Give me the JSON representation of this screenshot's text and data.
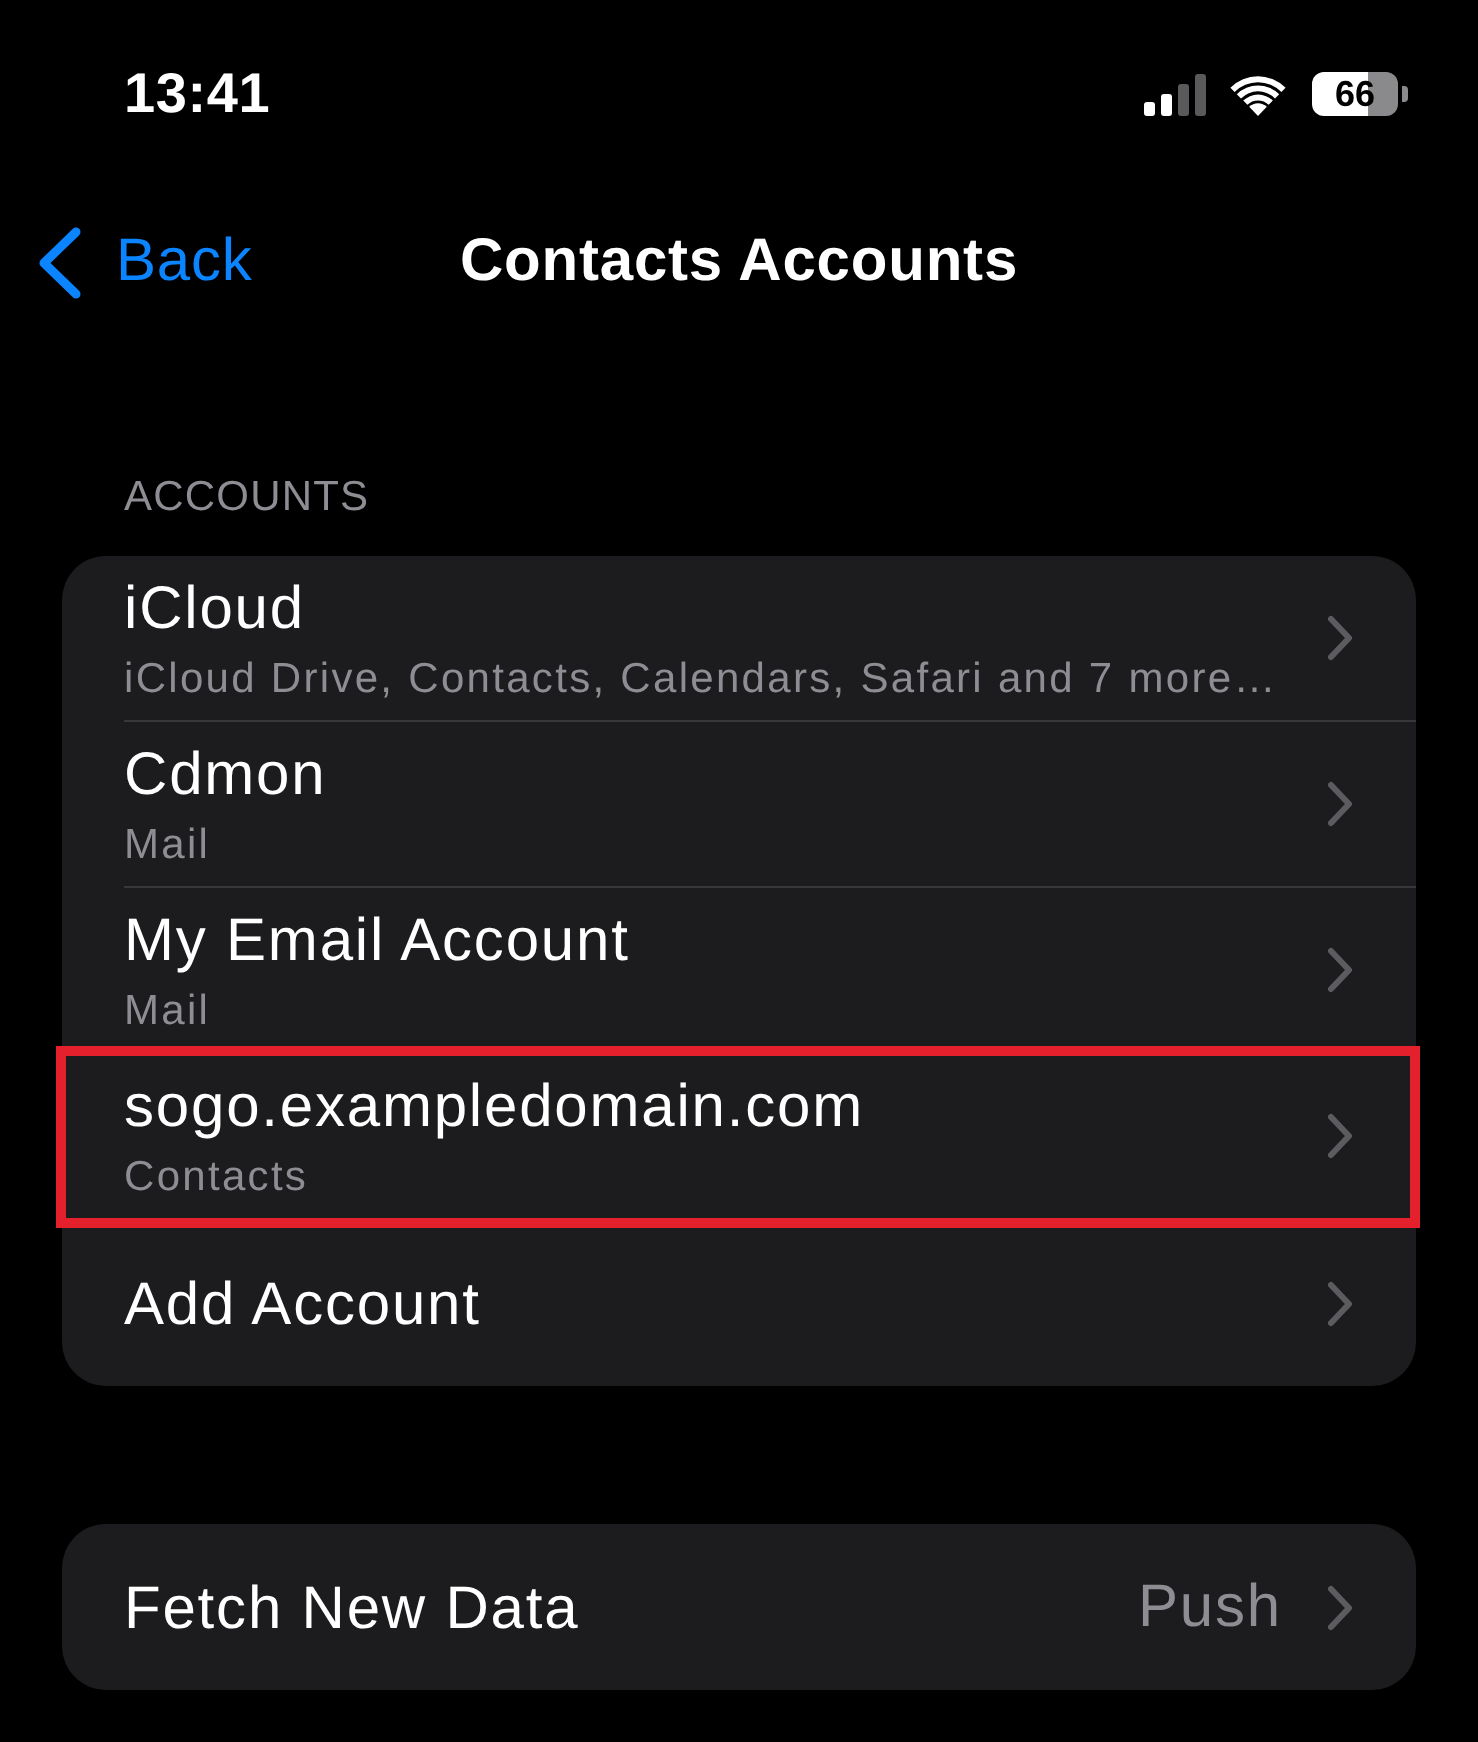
{
  "status_bar": {
    "time": "13:41",
    "battery_percent": "66"
  },
  "nav_bar": {
    "back_label": "Back",
    "title": "Contacts Accounts"
  },
  "accounts": {
    "header": "ACCOUNTS",
    "rows": [
      {
        "title": "iCloud",
        "subtitle": "iCloud Drive, Contacts, Calendars, Safari and 7 more…",
        "highlighted": false
      },
      {
        "title": "Cdmon",
        "subtitle": "Mail",
        "highlighted": false
      },
      {
        "title": "My Email Account",
        "subtitle": "Mail",
        "highlighted": false
      },
      {
        "title": "sogo.exampledomain.com",
        "subtitle": "Contacts",
        "highlighted": true
      },
      {
        "title": "Add Account",
        "highlighted": false
      }
    ]
  },
  "fetch": {
    "rows": [
      {
        "title": "Fetch New Data",
        "value": "Push"
      }
    ]
  }
}
